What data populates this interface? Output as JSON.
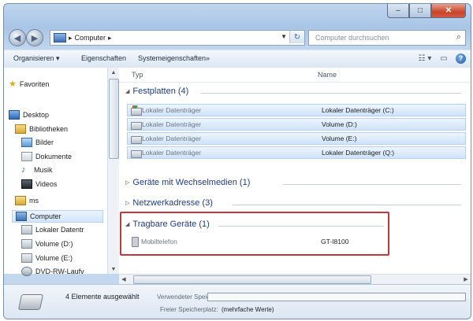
{
  "window": {
    "caption_buttons": [
      "–",
      "□",
      "✕"
    ]
  },
  "nav": {
    "back_icon": "back-arrow-icon",
    "forward_icon": "forward-arrow-icon",
    "breadcrumb": "Computer",
    "separator": "▸",
    "search_placeholder": "Computer durchsuchen"
  },
  "toolbar": {
    "organize": "Organisieren ▾",
    "properties": "Eigenschaften",
    "system_properties": "Systemeigenschaften",
    "more": "»"
  },
  "sidebar": {
    "items": [
      {
        "label": "Favoriten",
        "icon": "star-icon"
      },
      {
        "label": "Desktop",
        "icon": "desktop-icon"
      },
      {
        "label": "Bibliotheken",
        "icon": "library-icon"
      },
      {
        "label": "Bilder",
        "icon": "pictures-icon"
      },
      {
        "label": "Dokumente",
        "icon": "documents-icon"
      },
      {
        "label": "Musik",
        "icon": "music-icon"
      },
      {
        "label": "Videos",
        "icon": "videos-icon"
      },
      {
        "label": "ms",
        "icon": "user-folder-icon"
      },
      {
        "label": "Computer",
        "icon": "computer-icon"
      },
      {
        "label": "Lokaler Datentr",
        "icon": "system-drive-icon"
      },
      {
        "label": "Volume (D:)",
        "icon": "drive-icon"
      },
      {
        "label": "Volume (E:)",
        "icon": "drive-icon"
      },
      {
        "label": "DVD-RW-Laufv",
        "icon": "dvd-drive-icon"
      }
    ]
  },
  "columns": {
    "type": "Typ",
    "name": "Name"
  },
  "groups": {
    "hard_disks": {
      "label": "Festplatten (4)",
      "rows": [
        {
          "type": "Lokaler Datenträger",
          "name": "Lokaler Datenträger (C:)"
        },
        {
          "type": "Lokaler Datenträger",
          "name": "Volume (D:)"
        },
        {
          "type": "Lokaler Datenträger",
          "name": "Volume (E:)"
        },
        {
          "type": "Lokaler Datenträger",
          "name": "Lokaler Datenträger (Q:)"
        }
      ]
    },
    "removable": {
      "label": "Geräte mit Wechselmedien (1)"
    },
    "network": {
      "label": "Netzwerkadresse (3)"
    },
    "portable": {
      "label": "Tragbare Geräte (1)",
      "rows": [
        {
          "type": "Mobiltelefon",
          "name": "GT-I8100"
        }
      ]
    }
  },
  "status": {
    "selected": "4 Elemente ausgewählt",
    "used_label": "Verwendeter Speic...",
    "free_label": "Freier Speicherplatz:",
    "free_value": "(mehrfache Werte)"
  },
  "colors": {
    "highlight": "#c4373b",
    "group_text": "#1e3c8a",
    "selection": "#cfe3fa"
  }
}
